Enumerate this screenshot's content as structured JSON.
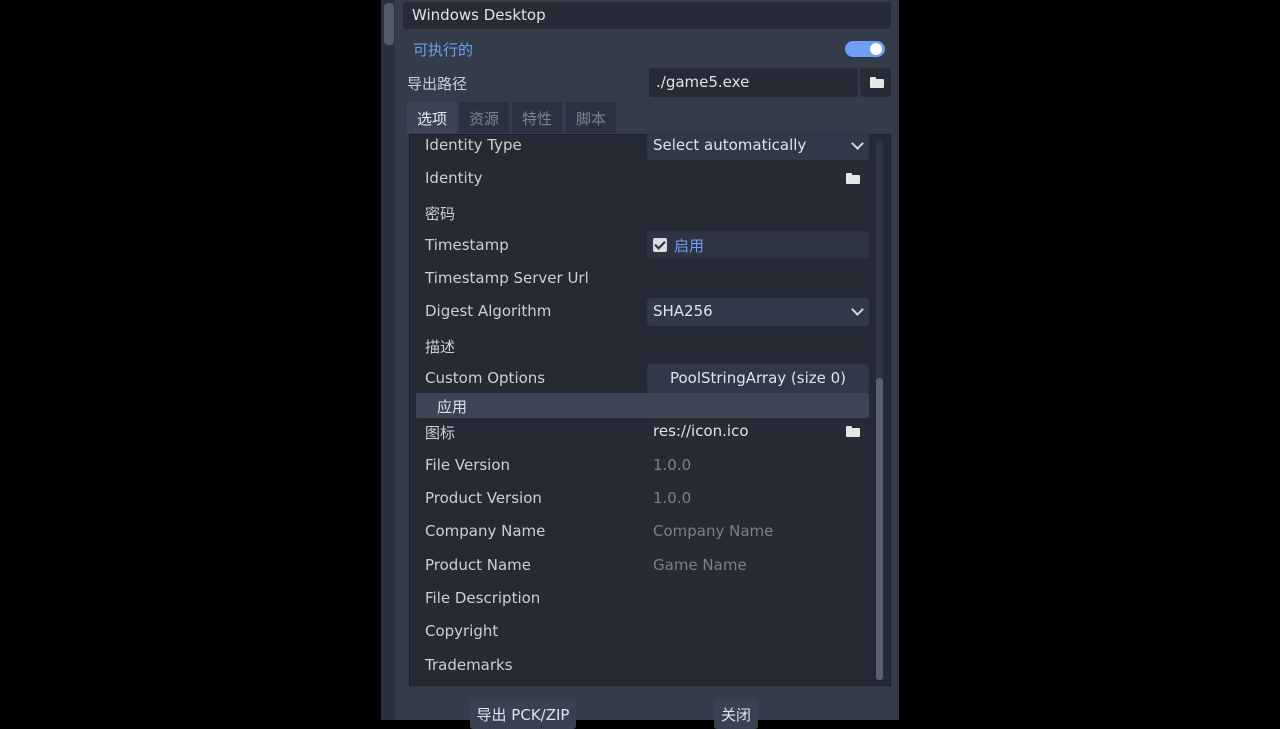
{
  "preset": {
    "name": "Windows Desktop",
    "runnable_label": "可执行的",
    "runnable": true
  },
  "export_path": {
    "label": "导出路径",
    "value": "./game5.exe"
  },
  "tabs": [
    {
      "label": "选项",
      "active": true
    },
    {
      "label": "资源",
      "active": false
    },
    {
      "label": "特性",
      "active": false
    },
    {
      "label": "脚本",
      "active": false
    }
  ],
  "options": {
    "identity_type": {
      "label": "Identity Type",
      "value": "Select automatically"
    },
    "identity": {
      "label": "Identity",
      "value": ""
    },
    "password": {
      "label": "密码",
      "value": ""
    },
    "timestamp": {
      "label": "Timestamp",
      "checkbox_label": "启用",
      "checked": true
    },
    "timestamp_server_url": {
      "label": "Timestamp Server Url",
      "value": ""
    },
    "digest_algorithm": {
      "label": "Digest Algorithm",
      "value": "SHA256"
    },
    "description": {
      "label": "描述",
      "value": ""
    },
    "custom_options": {
      "label": "Custom Options",
      "value": "PoolStringArray (size 0)"
    },
    "application_section": "应用",
    "icon": {
      "label": "图标",
      "value": "res://icon.ico"
    },
    "file_version": {
      "label": "File Version",
      "placeholder": "1.0.0"
    },
    "product_version": {
      "label": "Product Version",
      "placeholder": "1.0.0"
    },
    "company_name": {
      "label": "Company Name",
      "placeholder": "Company Name"
    },
    "product_name": {
      "label": "Product Name",
      "placeholder": "Game Name"
    },
    "file_description": {
      "label": "File Description",
      "value": ""
    },
    "copyright": {
      "label": "Copyright",
      "value": ""
    },
    "trademarks": {
      "label": "Trademarks",
      "value": ""
    }
  },
  "footer": {
    "export_pck_label": "导出 PCK/ZIP",
    "close_label": "关闭"
  },
  "colors": {
    "accent": "#6f9ef5",
    "panel_bg": "#343b49",
    "field_bg": "#262b36"
  }
}
